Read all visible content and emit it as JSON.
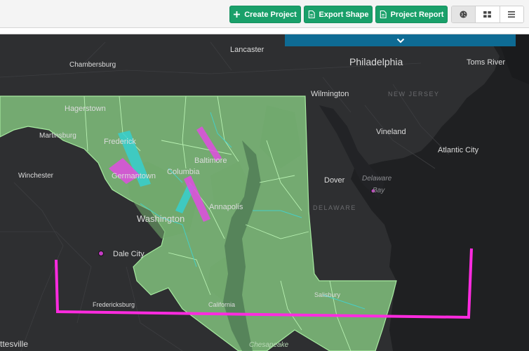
{
  "toolbar": {
    "create_project": "Create Project",
    "export_shape": "Export Shape",
    "project_report": "Project Report",
    "accent_color": "#1aa06a"
  },
  "view_toggle": {
    "icons": [
      "globe-icon",
      "grid-icon",
      "list-icon"
    ],
    "active": "globe"
  },
  "panel_toggle": {
    "icon": "chevron-down-icon",
    "color": "#0e6b94"
  },
  "map": {
    "highlight_color": "#90d98a",
    "boundary_color": "#ff2be0",
    "labels": {
      "lancaster": "Lancaster",
      "chambersburg": "Chambersburg",
      "philadelphia": "Philadelphia",
      "toms_river": "Toms River",
      "wilmington": "Wilmington",
      "new_jersey": "NEW JERSEY",
      "hagerstown": "Hagerstown",
      "martinsburg": "Martinsburg",
      "frederick": "Frederick",
      "vineland": "Vineland",
      "atlantic_city": "Atlantic City",
      "baltimore": "Baltimore",
      "columbia": "Columbia",
      "germantown": "Germantown",
      "winchester": "Winchester",
      "dover": "Dover",
      "delaware_bay": "Delaware",
      "bay": "Bay",
      "annapolis": "Annapolis",
      "delaware_state": "DELAWARE",
      "washington": "Washington",
      "dale_city": "Dale City",
      "salisbury": "Salisbury",
      "fredericksburg": "Fredericksburg",
      "california": "California",
      "chesapeake": "Chesapeake",
      "charlottesville": "ttesville"
    }
  }
}
